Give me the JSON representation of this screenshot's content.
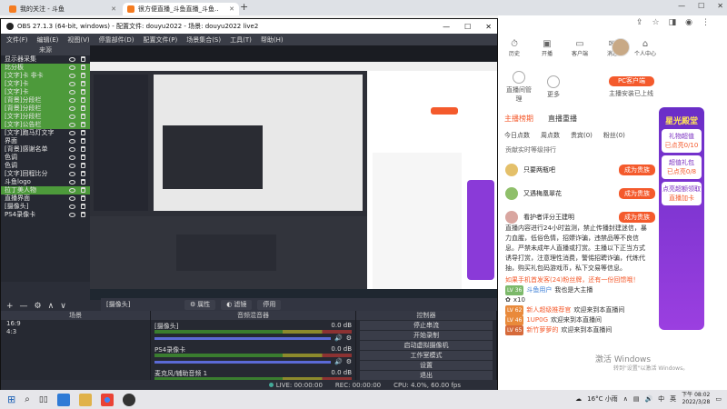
{
  "chrome": {
    "tabs": [
      {
        "label": "我的关注 - 斗鱼",
        "active": false
      },
      {
        "label": "很方便直播_斗鱼直播_斗鱼..",
        "active": true
      }
    ],
    "new_tab": "+"
  },
  "obs": {
    "title": "OBS 27.1.3 (64-bit, windows) - 配置文件: douyu2022 - 场景: douyu2022 live2",
    "menu": [
      "文件(F)",
      "编辑(E)",
      "视图(V)",
      "停靠部件(D)",
      "配置文件(P)",
      "场景集合(S)",
      "工具(T)",
      "帮助(H)"
    ],
    "sources_header": "来源",
    "sources": [
      {
        "label": "显示器采集",
        "selected": false
      },
      {
        "label": "比分板",
        "selected": true
      },
      {
        "label": "[文字]卡 非卡",
        "selected": true
      },
      {
        "label": "[文字]卡",
        "selected": true
      },
      {
        "label": "[文字]卡",
        "selected": true
      },
      {
        "label": "[背景]分段栏",
        "selected": true
      },
      {
        "label": "[背景]分段栏",
        "selected": true
      },
      {
        "label": "[文字]分段栏",
        "selected": true
      },
      {
        "label": "[文字]公告栏",
        "selected": true
      },
      {
        "label": "[文字]跑马灯文字",
        "selected": false
      },
      {
        "label": "界面",
        "selected": false
      },
      {
        "label": "[背景]感谢名单",
        "selected": false
      },
      {
        "label": "色调",
        "selected": false
      },
      {
        "label": "色调",
        "selected": false
      },
      {
        "label": "[文字]回程比分",
        "selected": false
      },
      {
        "label": "斗鱼logo",
        "selected": false
      },
      {
        "label": "拉丁美人物",
        "selected": true
      },
      {
        "label": "直播界面",
        "selected": false
      },
      {
        "label": "[摄像头]",
        "selected": false
      },
      {
        "label": "PS4录像卡",
        "selected": false
      }
    ],
    "toolbar": {
      "source_name": "[摄像头]",
      "properties": "属性",
      "filters": "滤镜",
      "deactivate": "停用"
    },
    "scenes_header": "场景",
    "scenes": [
      "16:9",
      "4:3"
    ],
    "mixer_header": "音频混音器",
    "mixer": [
      {
        "name": "[摄像头]",
        "db": "0.0 dB"
      },
      {
        "name": "PS4录像卡",
        "db": "0.0 dB"
      },
      {
        "name": "麦克风/辅助音频 1",
        "db": "0.0 dB"
      }
    ],
    "controls_header": "控制器",
    "controls": [
      "停止串流",
      "开始录制",
      "启动虚拟摄像机",
      "工作室模式",
      "设置",
      "退出"
    ],
    "status": {
      "live": "LIVE: 00:00:00",
      "rec": "REC: 00:00:00",
      "cpu": "CPU: 4.0%, 60.00 fps"
    }
  },
  "web": {
    "header_icons": [
      {
        "label": "历史",
        "symbol": "⏱"
      },
      {
        "label": "开播",
        "symbol": "▣"
      },
      {
        "label": "客户端",
        "symbol": "▭"
      },
      {
        "label": "消息",
        "symbol": "✉"
      },
      {
        "label": "个人中心",
        "symbol": "⌂"
      }
    ],
    "caster_tools": [
      {
        "label": "直播间管理"
      },
      {
        "label": "更多"
      }
    ],
    "pc_button": "PC客户端",
    "pc_sub": "主播安装已上线",
    "rank_tabs": [
      "主播榜期",
      "直播重播"
    ],
    "rank_subtabs": [
      "今日点数",
      "周点数",
      "贵宾(0)",
      "粉丝(0)"
    ],
    "rank_title": "贡献实时等级排行",
    "rank_entries": [
      {
        "name": "只要两瓶吧",
        "button": "成为贵族",
        "avatar_color": "#e4c06a"
      },
      {
        "name": "又遇梅凰翠花",
        "button": "成为贵族",
        "avatar_color": "#8fbf6a"
      },
      {
        "name": "看护者评分王建明",
        "button": "成为贵族",
        "avatar_color": "#d9a6a0"
      }
    ],
    "chat": [
      {
        "text": "直播内容进行24小时监测，禁止传播封建迷信，暴"
      },
      {
        "text": "力血腥，低俗色情，招嫖诈骗，违禁品等不良信"
      },
      {
        "text": "息。严禁未成年人直播或打赏。主播以下正当方式"
      },
      {
        "text": "诱导打赏，注意理性消费，警惕招聘诈骗，代练代"
      },
      {
        "text": "抽，购买礼包码游戏币，私下交易等信息。"
      },
      {
        "text": "如果手机首发客(24)粉丝牌，还有一份回馈哦！"
      },
      {
        "level": "LV 36",
        "name": "斗鱼用户",
        "msg": "我也是大主播"
      },
      {
        "level": "",
        "name": "",
        "msg": "x10"
      },
      {
        "level": "LV 62",
        "name": "新人超级推荐官",
        "msg": "欢迎来到本直播间"
      },
      {
        "level": "LV 46",
        "name": "1UP0G",
        "msg": "欢迎来到本直播间"
      },
      {
        "level": "LV 65",
        "name": "新竹萝萝的",
        "msg": "欢迎来到本直播间"
      }
    ],
    "promo": [
      "星光殿堂",
      "礼物超值",
      "已点亮0/10",
      "超值礼包",
      "已点亮0/8",
      "点亮超额领取",
      "直播加卡"
    ],
    "watermark": "激活 Windows",
    "watermark_sub": "转到\"设置\"以激活 Windows。"
  },
  "taskbar": {
    "weather": "16°C 小雨",
    "ime": "中",
    "lang": "英",
    "time": "下午 08:02",
    "date": "2022/3/28"
  },
  "colors": {
    "obs_bg": "#2b2e38",
    "accent_green": "#4d9a3b",
    "douyu_orange": "#f45a2c"
  }
}
